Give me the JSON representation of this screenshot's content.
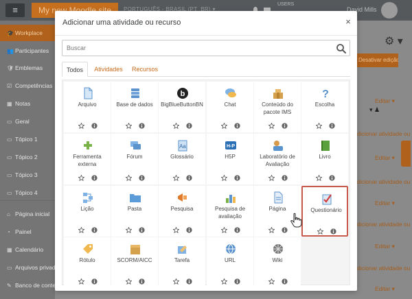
{
  "colors": {
    "accent": "#c46a1b",
    "header_bar": "#55595c",
    "selected_border": "#c9584d"
  },
  "background": {
    "menu_icon": "≡",
    "site_name": "My new Moodle site",
    "language": "PORTUGUÊS - BRASIL (PT_BR) ▾",
    "users_label": "USERS",
    "user_name": "David Mills",
    "sidebar": [
      {
        "label": "Workplace",
        "icon": "🎓"
      },
      {
        "label": "Participantes",
        "icon": "👥"
      },
      {
        "label": "Emblemas",
        "icon": "🛡"
      },
      {
        "label": "Competências",
        "icon": "☑"
      },
      {
        "label": "Notas",
        "icon": "▦"
      },
      {
        "label": "Geral",
        "icon": "▭"
      },
      {
        "label": "Tópico 1",
        "icon": "▭"
      },
      {
        "label": "Tópico 2",
        "icon": "▭"
      },
      {
        "label": "Tópico 3",
        "icon": "▭"
      },
      {
        "label": "Tópico 4",
        "icon": "▭"
      },
      {
        "label": "Página inicial",
        "icon": "⌂"
      },
      {
        "label": "Painel",
        "icon": "◔"
      },
      {
        "label": "Calendário",
        "icon": "▦"
      },
      {
        "label": "Arquivos privados",
        "icon": "▭"
      },
      {
        "label": "Banco de conteúdo",
        "icon": "✎"
      }
    ],
    "edit_button": "Desativar edição",
    "edit_links": [
      "Editar ▾",
      "Editar ▾",
      "Editar ▾",
      "Editar ▾",
      "Editar ▾",
      "Editar ▾"
    ],
    "add_resource_links": [
      "+ Adicionar atividade ou recurso",
      "+ Adicionar atividade ou recurso",
      "+ Adicionar atividade ou recurso",
      "+ Adicionar atividade ou recurso",
      "+ Adicionar atividade ou recurso"
    ],
    "person_icon": "▾ ♟",
    "gear_icon": "⚙ ▾"
  },
  "modal": {
    "title": "Adicionar uma atividade ou recurso",
    "close_label": "×",
    "search_placeholder": "Buscar",
    "tabs": [
      {
        "label": "Todos",
        "active": true
      },
      {
        "label": "Atividades",
        "active": false
      },
      {
        "label": "Recursos",
        "active": false
      }
    ],
    "modules": [
      {
        "name": "Arquivo",
        "icon": "file-icon"
      },
      {
        "name": "Base de dados",
        "icon": "database-icon"
      },
      {
        "name": "BigBlueButtonBN",
        "icon": "bigbluebutton-icon"
      },
      {
        "name": "Chat",
        "icon": "chat-icon"
      },
      {
        "name": "Conteúdo do pacote IMS",
        "icon": "ims-package-icon"
      },
      {
        "name": "Escolha",
        "icon": "choice-icon"
      },
      {
        "name": "Ferramenta externa",
        "icon": "external-tool-icon"
      },
      {
        "name": "Fórum",
        "icon": "forum-icon"
      },
      {
        "name": "Glossário",
        "icon": "glossary-icon"
      },
      {
        "name": "H5P",
        "icon": "h5p-icon"
      },
      {
        "name": "Laboratório de Avaliação",
        "icon": "workshop-icon"
      },
      {
        "name": "Livro",
        "icon": "book-icon"
      },
      {
        "name": "Lição",
        "icon": "lesson-icon"
      },
      {
        "name": "Pasta",
        "icon": "folder-icon"
      },
      {
        "name": "Pesquisa",
        "icon": "survey-icon"
      },
      {
        "name": "Pesquisa de avaliação",
        "icon": "feedback-icon"
      },
      {
        "name": "Página",
        "icon": "page-icon"
      },
      {
        "name": "Questionário",
        "icon": "quiz-icon",
        "selected": true
      },
      {
        "name": "Rótulo",
        "icon": "label-icon"
      },
      {
        "name": "SCORM/AICC",
        "icon": "scorm-icon"
      },
      {
        "name": "Tarefa",
        "icon": "assignment-icon"
      },
      {
        "name": "URL",
        "icon": "url-icon"
      },
      {
        "name": "Wiki",
        "icon": "wiki-icon"
      }
    ]
  }
}
